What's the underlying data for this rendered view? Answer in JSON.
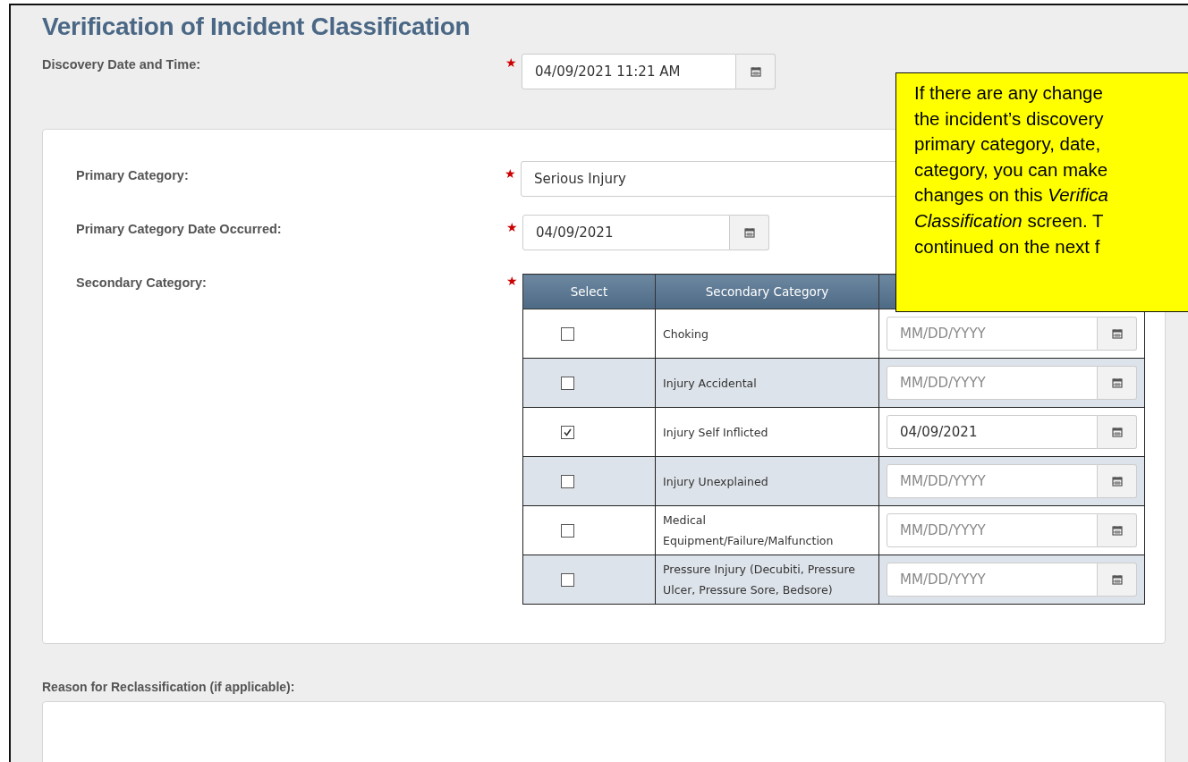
{
  "title": "Verification of Incident Classification",
  "discovery": {
    "label": "Discovery Date and Time:",
    "required_mark": "★",
    "value": "04/09/2021 11:21 AM"
  },
  "primary_category": {
    "label": "Primary Category:",
    "required_mark": "★",
    "value": "Serious Injury"
  },
  "primary_date": {
    "label": "Primary Category Date Occurred:",
    "required_mark": "★",
    "value": "04/09/2021"
  },
  "secondary": {
    "label": "Secondary Category:",
    "required_mark": "★",
    "columns": [
      "Select",
      "Secondary Category"
    ],
    "rows": [
      {
        "name": "Choking",
        "checked": false,
        "placeholder": "MM/DD/YYYY"
      },
      {
        "name": "Injury Accidental",
        "checked": false,
        "placeholder": "MM/DD/YYYY"
      },
      {
        "name": "Injury Self Inflicted",
        "checked": true,
        "value": "04/09/2021"
      },
      {
        "name": "Injury Unexplained",
        "checked": false,
        "placeholder": "MM/DD/YYYY"
      },
      {
        "name": "Medical Equipment/Failure/Malfunction",
        "checked": false,
        "placeholder": "MM/DD/YYYY"
      },
      {
        "name": "Pressure Injury (Decubiti, Pressure Ulcer, Pressure Sore, Bedsore)",
        "checked": false,
        "placeholder": "MM/DD/YYYY"
      }
    ]
  },
  "reason": {
    "label": "Reason for Reclassification (if applicable):"
  },
  "callout": {
    "lines": [
      "If there are any change",
      "the incident’s discovery",
      "primary category, date,",
      "category, you can make",
      "changes on this *Verifica*",
      "*Classification* screen. T",
      "continued on the next f"
    ]
  }
}
